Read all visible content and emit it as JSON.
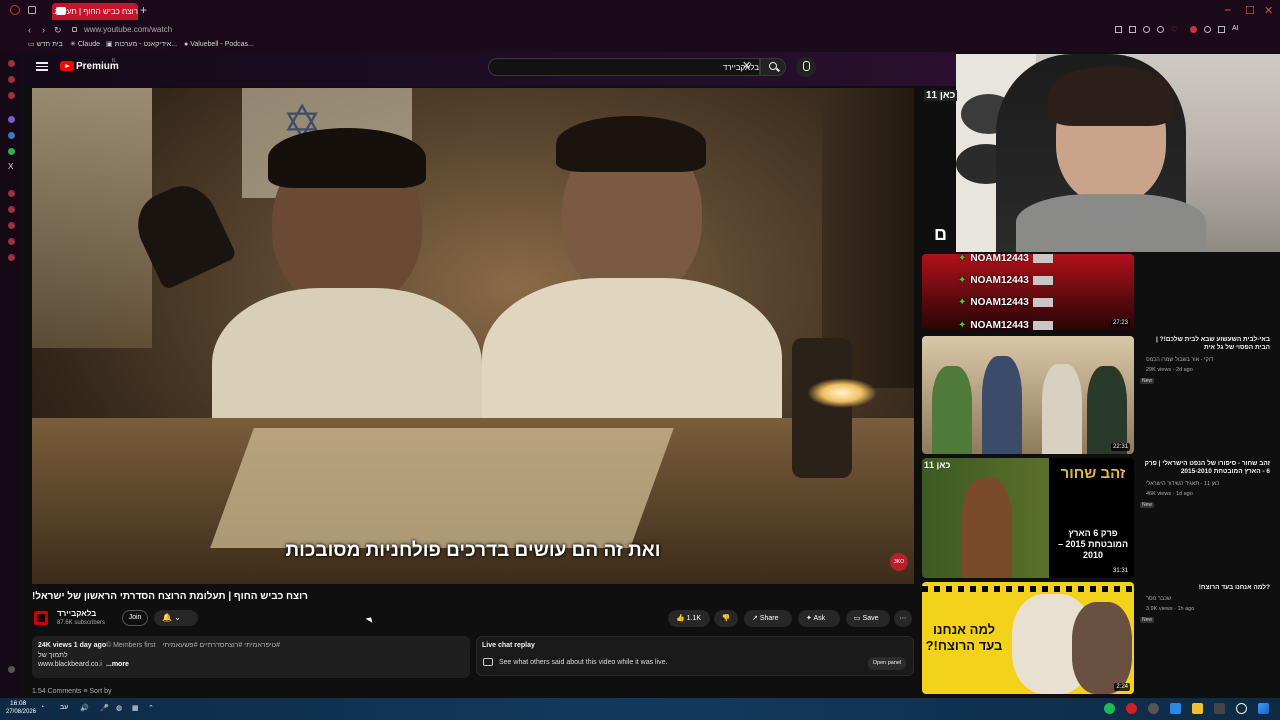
{
  "browser": {
    "tab_title": "רוצח כביש החוף | תעלומ...",
    "new_tab": "+",
    "url": "www.youtube.com/watch",
    "bookmarks": [
      "בית חדש",
      "Claude",
      "אידיקאנט - מערכות...",
      "Valuebell - Podcas..."
    ],
    "profile_label": "AI"
  },
  "header": {
    "logo_text": "Premium",
    "logo_region": "IL",
    "search_value": "בלאקביירד",
    "clear_icon": "✕"
  },
  "video": {
    "subtitle": "ואת זה הם עושים בדרכים פולחניות מסובכות",
    "corner_badge": "3KO",
    "title": "רוצח כביש החוף | תעלומת הרוצח הסדרתי הראשון של ישראל!"
  },
  "channel": {
    "name": "בלאקביירד",
    "subscribers": "87.6K subscribers",
    "join_label": "Join",
    "bell_label": "🔔 ⌄"
  },
  "actions": {
    "likes": "1.1K",
    "share": "Share",
    "ask": "Ask",
    "save": "Save",
    "more": "⋯"
  },
  "description": {
    "views_age": "24K views  1 day ago",
    "members": "© Members first",
    "tags": "#טיפראמיתי #רוצחסדרתיים #פשעאמיתי",
    "line2": "לתמוך של",
    "link": "www.blackbeard.co.i",
    "more": "...more"
  },
  "live_chat": {
    "title": "Live chat replay",
    "desc": "See what others said about this video while it was live.",
    "open_panel": "Open panel"
  },
  "comments_peek": "1.54 Comments   ≡ Sort by",
  "overlay": {
    "noam_rows": [
      "NOAM12443",
      "NOAM12443",
      "NOAM12443",
      "NOAM12443"
    ],
    "webcam_side_badge": "כאן 11",
    "webcam_letter": "ם"
  },
  "recommendations": [
    {
      "duration": "27:23",
      "title": "",
      "meta": "",
      "badge": ""
    },
    {
      "duration": "22:31",
      "title": "באי-לבית השעשוע שבא לבית שלכם!? | הבית הפסוי של גל אית",
      "meta": "דוקי - אור בשבול שמרו הכמס",
      "stats": "29K views · 2d ago",
      "badge": "New"
    },
    {
      "duration": "31:31",
      "title": "זהב שחור - סיפורו של הנפט הישראלי | פרק 6 - הארץ המובטחת 2015-2010",
      "meta": "כאן 11 - תאגיד השידור הישראלי",
      "stats": "46K views · 1d ago",
      "badge": "New",
      "thumb_badge": "כאן 11",
      "thumb_text": "זהב שחור",
      "thumb_sub": "פרק 6 הארץ המובטחת 2015 – 2010"
    },
    {
      "duration": "2:24",
      "title": "?למה אנחנו בעד הרוצח!",
      "meta": "שכבר מסר",
      "stats": "3.9K views · 1h ago",
      "badge": "New",
      "thumb_text": "למה אנחנו בעד הרוצח!?"
    }
  ],
  "taskbar": {
    "time": "16:08",
    "date": "27/08/2026",
    "lang": "עב"
  },
  "colors": {
    "accent": "#ff0000",
    "tab_active": "#c4152e",
    "overlay_star": "#3fcf3f"
  }
}
